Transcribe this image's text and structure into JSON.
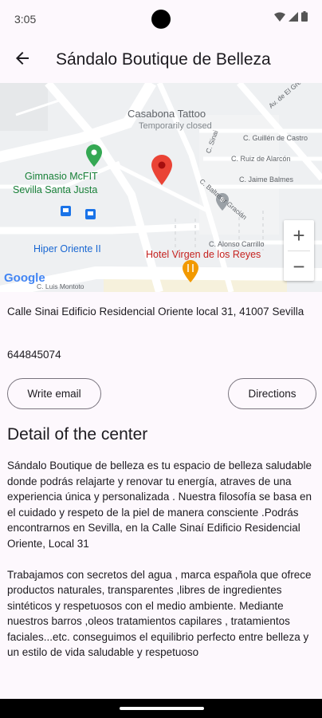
{
  "status_bar": {
    "time": "3:05"
  },
  "app_bar": {
    "title": "Sándalo Boutique de Belleza"
  },
  "map": {
    "places": {
      "tattoo_name": "Casabona Tattoo",
      "tattoo_status": "Temporarily closed",
      "gym_line1": "Gimnasio McFIT",
      "gym_line2": "Sevilla Santa Justa",
      "market": "Hiper Oriente II",
      "hotel": "Hotel Virgen de los Reyes"
    },
    "streets": {
      "guillen": "C. Guillén de Castro",
      "ruiz": "C. Ruiz de Alarcón",
      "jaime": "C. Jaime Balmes",
      "baltasar": "C. Baltasar Gracián",
      "alonso": "C. Alonso Carrillo",
      "greco": "Av. de El Greco",
      "sinai": "C. Sinai",
      "luis": "C. Luis Montoto"
    },
    "attribution": "Google",
    "zoom_in": "+",
    "zoom_out": "−"
  },
  "center": {
    "address": "Calle Sinai Edificio Residencial Oriente local 31, 41007 Sevilla",
    "phone": "644845074"
  },
  "actions": {
    "write_email": "Write email",
    "directions": "Directions"
  },
  "detail": {
    "title": "Detail of the center",
    "paragraph1": "Sándalo Boutique de belleza es tu espacio de belleza saludable donde podrás relajarte y renovar  tu energía, atraves de una experiencia única y personalizada . Nuestra filosofía se basa en el cuidado y respeto de la piel de manera consciente .Podrás encontrarnos en Sevilla, en la Calle Sinaí Edificio Residencial Oriente, Local 31",
    "paragraph2": "Trabajamos con secretos del agua , marca española que ofrece productos naturales, transparentes ,libres de ingredientes sintéticos y respetuosos con el medio ambiente. Mediante nuestros barros ,oleos tratamientos capilares , tratamientos faciales...etc. conseguimos el equilibrio perfecto entre belleza y un estilo de vida saludable y respetuoso"
  },
  "colors": {
    "background": "#fdf8fd",
    "map_pin": "#ea4335",
    "gym_pin": "#34a853",
    "food_pin": "#f29900",
    "hotel_pin": "#e8457b",
    "transit": "#1a73e8"
  }
}
